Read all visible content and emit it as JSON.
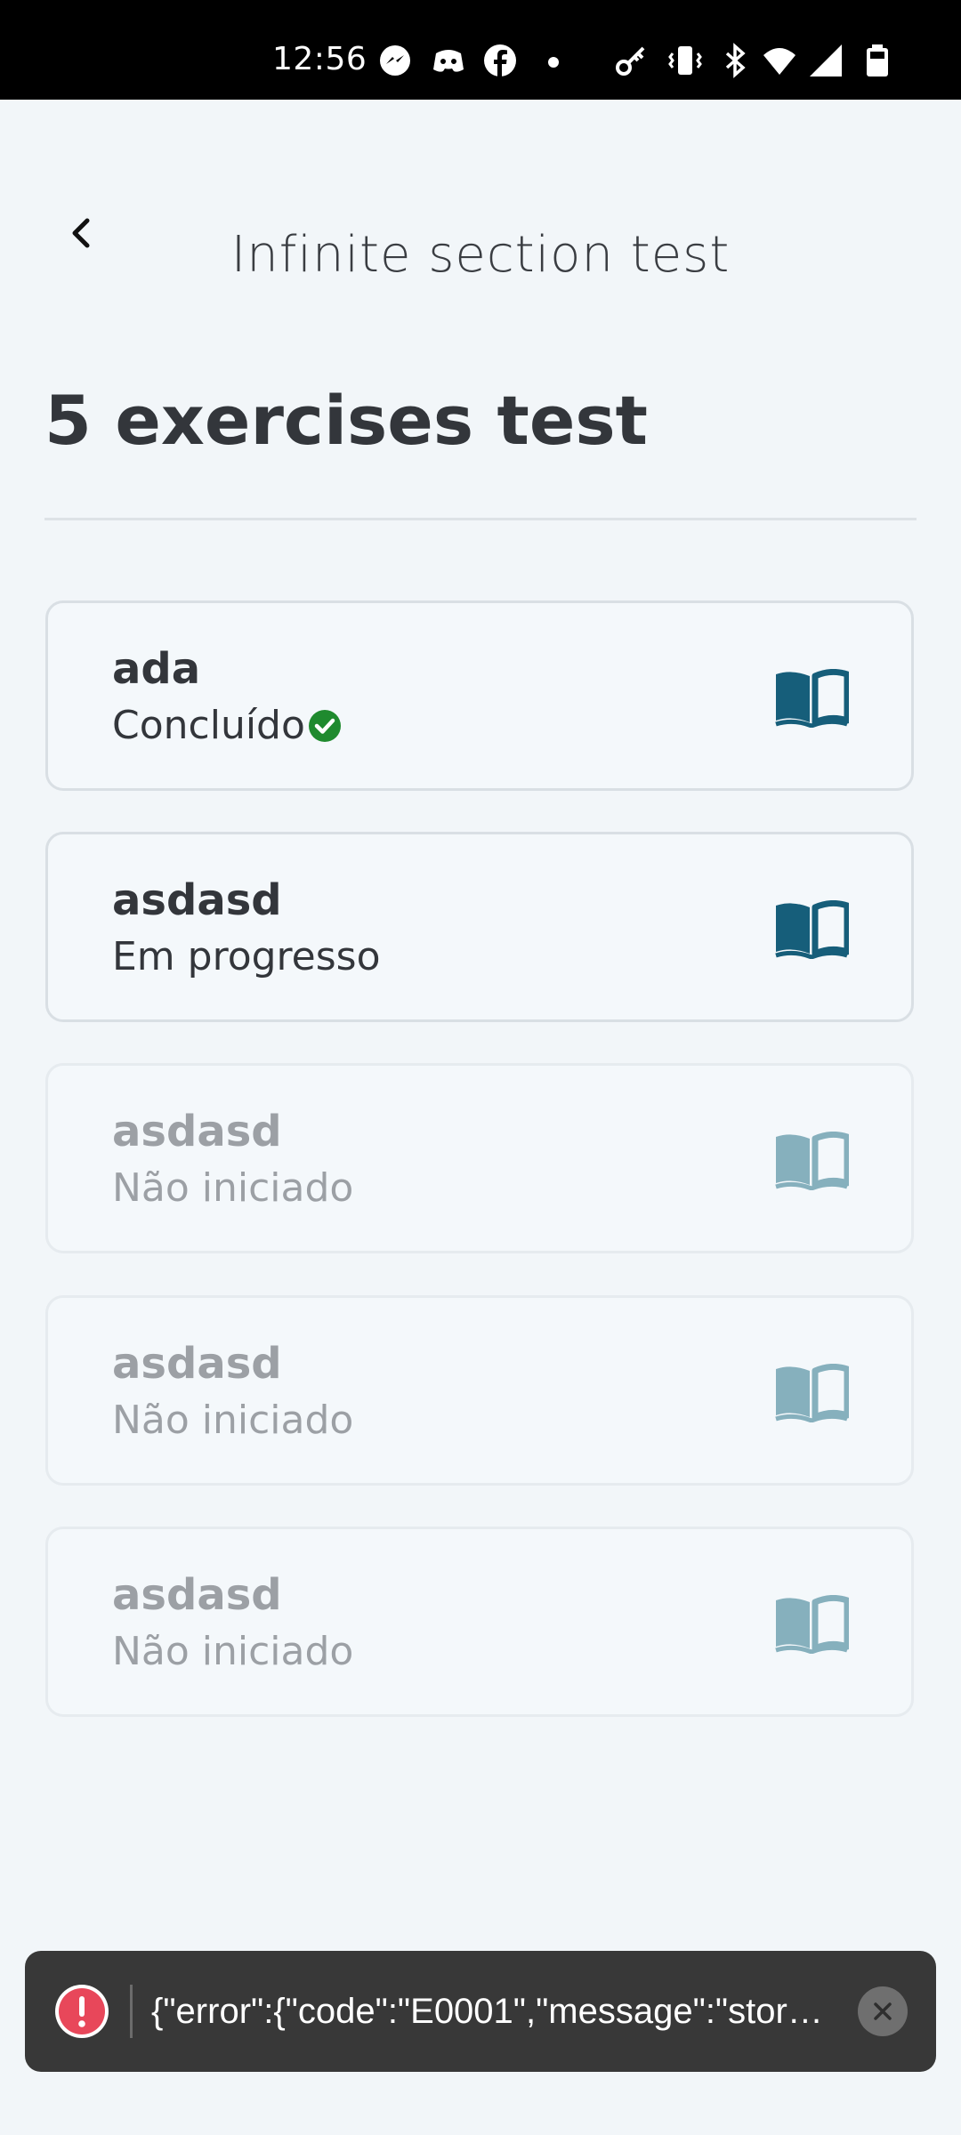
{
  "status_bar": {
    "time": "12:56",
    "icons": [
      "messenger-icon",
      "discord-icon",
      "facebook-icon",
      "dot-icon",
      "key-icon",
      "vibrate-icon",
      "bluetooth-icon",
      "wifi-icon",
      "signal-icon",
      "battery-icon"
    ]
  },
  "header": {
    "title": "Infinite section test"
  },
  "page": {
    "title": "5 exercises test"
  },
  "exercises": [
    {
      "title": "ada",
      "status": "Concluído",
      "completed": true,
      "enabled": true
    },
    {
      "title": "asdasd",
      "status": "Em progresso",
      "completed": false,
      "enabled": true
    },
    {
      "title": "asdasd",
      "status": "Não iniciado",
      "completed": false,
      "enabled": false
    },
    {
      "title": "asdasd",
      "status": "Não iniciado",
      "completed": false,
      "enabled": false
    },
    {
      "title": "asdasd",
      "status": "Não iniciado",
      "completed": false,
      "enabled": false
    }
  ],
  "toast": {
    "message": "{\"error\":{\"code\":\"E0001\",\"message\":\"storag..."
  },
  "colors": {
    "book_active": "#165e7a",
    "book_inactive": "#86b0bd",
    "check": "#1f8a2e",
    "error": "#e8475a"
  }
}
